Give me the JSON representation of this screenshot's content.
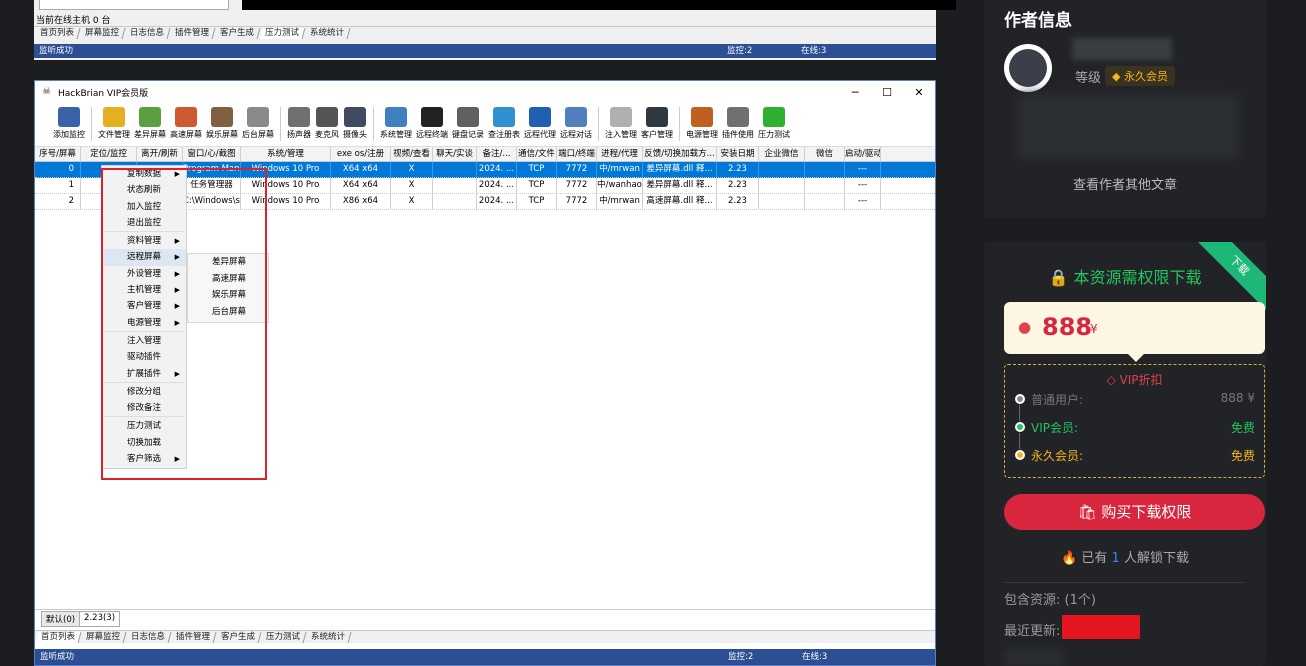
{
  "top_window": {
    "online_text": "当前在线主机 0 台",
    "tabs": [
      "首页列表",
      "屏幕监控",
      "日志信息",
      "插件管理",
      "客户生成",
      "压力测试",
      "系统统计"
    ],
    "active_tab": 5,
    "status_left": "监听成功",
    "status_monitor": "监控:2",
    "status_online": "在线:3"
  },
  "main_window": {
    "title": "HackBrian VIP会员版",
    "controls": {
      "minimize": "─",
      "maximize": "☐",
      "close": "✕"
    },
    "toolbar": [
      {
        "label": "添加监控",
        "color": "#3a62a8"
      },
      {
        "label": "文件管理",
        "color": "#e3b020"
      },
      {
        "label": "差异屏幕",
        "color": "#5aa040"
      },
      {
        "label": "高速屏幕",
        "color": "#d05a30"
      },
      {
        "label": "娱乐屏幕",
        "color": "#806040"
      },
      {
        "label": "后台屏幕",
        "color": "#8a8a8a"
      },
      {
        "label": "扬声器",
        "color": "#707070"
      },
      {
        "label": "麦克风",
        "color": "#555555"
      },
      {
        "label": "摄像头",
        "color": "#404a60"
      },
      {
        "label": "系统管理",
        "color": "#4080c0"
      },
      {
        "label": "远程终端",
        "color": "#222222"
      },
      {
        "label": "键盘记录",
        "color": "#606060"
      },
      {
        "label": "查注册表",
        "color": "#3090d0"
      },
      {
        "label": "远程代理",
        "color": "#2060b0"
      },
      {
        "label": "远程对话",
        "color": "#5080c0"
      },
      {
        "label": "注入管理",
        "color": "#b0b0b0"
      },
      {
        "label": "客户管理",
        "color": "#303840"
      },
      {
        "label": "电源管理",
        "color": "#c06020"
      },
      {
        "label": "插件使用",
        "color": "#707070"
      },
      {
        "label": "压力测试",
        "color": "#30b030"
      }
    ],
    "columns": [
      "序号/屏幕",
      "定位/监控",
      "离开/刷新",
      "窗口/心/截图",
      "系统/管理",
      "exe os/注册",
      "视频/查看",
      "聊天/实谈",
      "备注/...",
      "通信/文件",
      "端口/终端",
      "进程/代理",
      "反馈/切换加载方...",
      "安装日期",
      "企业微信",
      "微信",
      "启动/驱动"
    ],
    "rows": [
      [
        "0",
        "",
        "",
        "Program Mana...",
        "Windows 10 Pro",
        "X64 x64",
        "X",
        "",
        "2024. ...",
        "TCP",
        "7772",
        "中/mrwan",
        "差异屏幕.dll 释...",
        "2.23",
        "",
        "",
        "---"
      ],
      [
        "1",
        "",
        "",
        "任务管理器",
        "Windows 10 Pro",
        "X64 x64",
        "X",
        "",
        "2024. ...",
        "TCP",
        "7772",
        "中/wanhao",
        "差异屏幕.dll 释...",
        "2.23",
        "",
        "",
        "---"
      ],
      [
        "2",
        "",
        "",
        "C:\\Windows\\sy...",
        "Windows 10 Pro",
        "X86 x64",
        "X",
        "",
        "2024. ...",
        "TCP",
        "7772",
        "中/mrwan",
        "高速屏幕.dll 释...",
        "2.23",
        "",
        "",
        "---"
      ]
    ],
    "context_menu": [
      {
        "label": "复制数据",
        "arrow": true
      },
      {
        "label": "状态刷新"
      },
      {
        "label": "加入监控"
      },
      {
        "label": "退出监控"
      },
      {
        "sep": true
      },
      {
        "label": "资料管理",
        "arrow": true
      },
      {
        "label": "远程屏幕",
        "arrow": true,
        "highlight": true
      },
      {
        "label": "外设管理",
        "arrow": true
      },
      {
        "label": "主机管理",
        "arrow": true
      },
      {
        "label": "客户管理",
        "arrow": true
      },
      {
        "label": "电源管理",
        "arrow": true
      },
      {
        "sep": true
      },
      {
        "label": "注入管理"
      },
      {
        "label": "驱动插件"
      },
      {
        "label": "扩展插件",
        "arrow": true
      },
      {
        "sep": true
      },
      {
        "label": "修改分组"
      },
      {
        "label": "修改备注"
      },
      {
        "sep": true
      },
      {
        "label": "压力测试"
      },
      {
        "label": "切换加载"
      },
      {
        "label": "客户筛选",
        "arrow": true
      }
    ],
    "submenu": [
      "差异屏幕",
      "高速屏幕",
      "娱乐屏幕",
      "后台屏幕"
    ],
    "group_tabs": [
      "默认(0)",
      "2.23(3)"
    ],
    "bottom_tabs": [
      "首页列表",
      "屏幕监控",
      "日志信息",
      "插件管理",
      "客户生成",
      "压力测试",
      "系统统计"
    ],
    "status_left": "监听成功",
    "status_monitor": "监控:2",
    "status_online": "在线:3"
  },
  "author_card": {
    "heading": "作者信息",
    "level_label": "等级",
    "level_badge": "永久会员",
    "other_articles": "查看作者其他文章"
  },
  "download_card": {
    "corner": "下载",
    "title": "本资源需权限下载",
    "price": "888",
    "currency": "¥",
    "vip_title": "VIP折扣",
    "tiers": [
      {
        "label": "普通用户:",
        "value": "888 ¥",
        "color": "#888888"
      },
      {
        "label": "VIP会员:",
        "value": "免费",
        "color": "#22c55e"
      },
      {
        "label": "永久会员:",
        "value": "免费",
        "color": "#f5b41e"
      }
    ],
    "buy_button": "购买下载权限",
    "unlock_prefix": "已有",
    "unlock_count": "1",
    "unlock_suffix": "人解锁下载",
    "includes": "包含资源: (1个)",
    "updated": "最近更新:"
  }
}
